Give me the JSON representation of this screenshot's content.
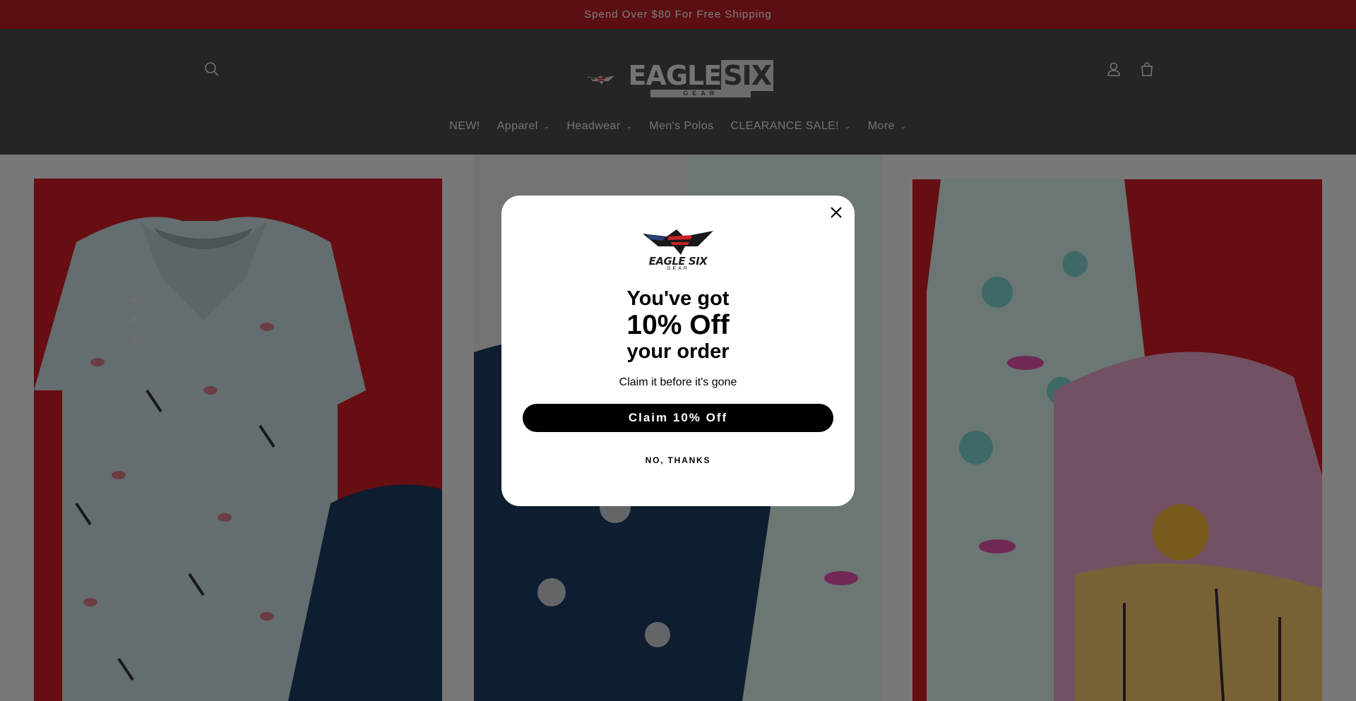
{
  "announcement": {
    "text": "Spend Over $80 For Free Shipping"
  },
  "header": {
    "logo_text": "EAGLE",
    "logo_text_bold": "SIX",
    "logo_sub": "GEAR",
    "search_icon": "search-icon",
    "account_icon": "account-icon",
    "cart_icon": "cart-icon"
  },
  "nav": {
    "items": [
      {
        "label": "NEW!",
        "dropdown": false
      },
      {
        "label": "Apparel",
        "dropdown": true
      },
      {
        "label": "Headwear",
        "dropdown": true
      },
      {
        "label": "Men's Polos",
        "dropdown": false
      },
      {
        "label": "CLEARANCE SALE!",
        "dropdown": true
      },
      {
        "label": "More",
        "dropdown": true
      }
    ]
  },
  "popup": {
    "logo_text": "EAGLE SIX",
    "logo_sub": "GEAR",
    "headline_1": "You've got",
    "headline_2": "10% Off",
    "headline_3": "your order",
    "subtext": "Claim it before it's gone",
    "claim_button": "Claim 10% Off",
    "decline_link": "NO, THANKS"
  },
  "colors": {
    "announcement_bg": "#b71f24",
    "header_bg": "#4a4a4a",
    "panel_red": "#cc1d24",
    "button_bg": "#000000"
  }
}
